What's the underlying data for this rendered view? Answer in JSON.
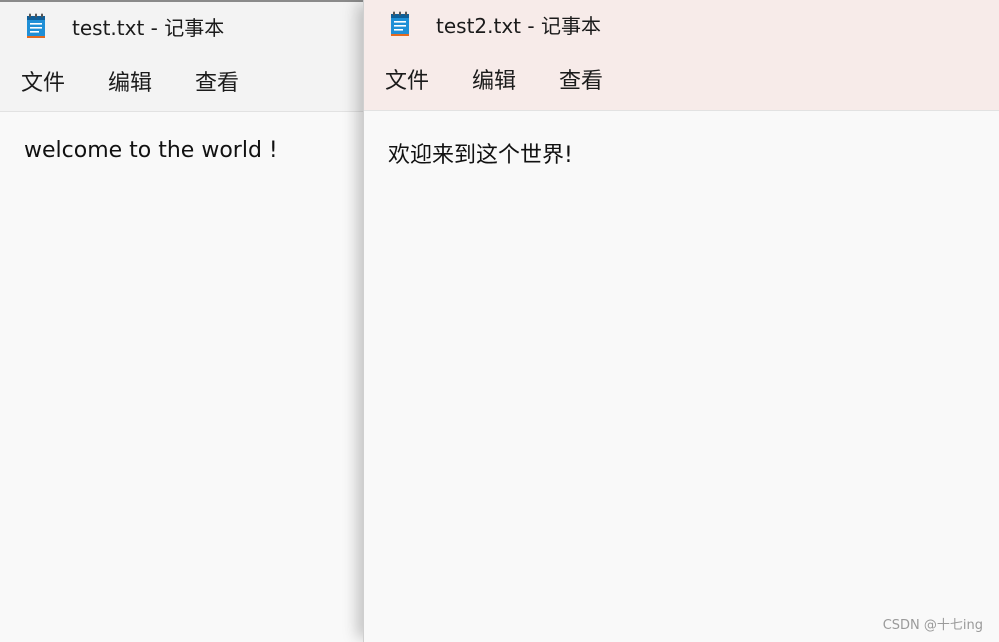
{
  "left_window": {
    "title": "test.txt - 记事本",
    "menu": [
      "文件",
      "编辑",
      "查看"
    ],
    "content": "welcome to the world !"
  },
  "right_window": {
    "title": "test2.txt - 记事本",
    "menu": [
      "文件",
      "编辑",
      "查看"
    ],
    "content": "欢迎来到这个世界!"
  },
  "watermark": "CSDN @十七ing",
  "icon": "notepad-icon",
  "colors": {
    "icon_blue": "#1f8fd6",
    "icon_dark": "#0f5f99",
    "icon_orange": "#e46a1f"
  }
}
